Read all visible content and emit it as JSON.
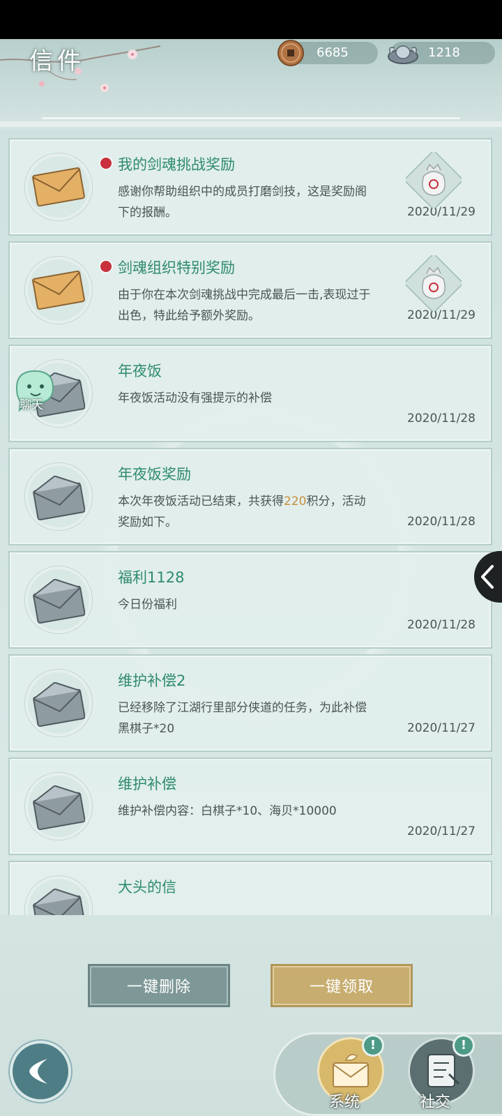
{
  "header": {
    "title": "信件",
    "copper_amount": "6685",
    "silver_amount": "1218"
  },
  "mails": [
    {
      "title": "我的剑魂挑战奖励",
      "body": "感谢你帮助组织中的成员打磨剑技，这是奖励阁下的报酬。",
      "date": "2020/11/29",
      "unread": true,
      "opened": false,
      "has_attachment": true
    },
    {
      "title": "剑魂组织特别奖励",
      "body": "由于你在本次剑魂挑战中完成最后一击,表现过于出色，特此给予额外奖励。",
      "date": "2020/11/29",
      "unread": true,
      "opened": false,
      "has_attachment": true
    },
    {
      "title": "年夜饭",
      "body": "年夜饭活动没有强提示的补偿",
      "date": "2020/11/28",
      "unread": false,
      "opened": true,
      "has_attachment": false
    },
    {
      "title": "年夜饭奖励",
      "body_before": "本次年夜饭活动已结束，共获得",
      "body_highlight": "220",
      "body_after": "积分，活动奖励如下。",
      "date": "2020/11/28",
      "unread": false,
      "opened": true,
      "has_attachment": false
    },
    {
      "title": "福利1128",
      "body": "今日份福利",
      "date": "2020/11/28",
      "unread": false,
      "opened": true,
      "has_attachment": false
    },
    {
      "title": "维护补偿2",
      "body": "已经移除了江湖行里部分侠道的任务，为此补偿黑棋子*20",
      "date": "2020/11/27",
      "unread": false,
      "opened": true,
      "has_attachment": false
    },
    {
      "title": "维护补偿",
      "body": "维护补偿内容：白棋子*10、海贝*10000",
      "date": "2020/11/27",
      "unread": false,
      "opened": true,
      "has_attachment": false
    },
    {
      "title": "大头的信",
      "body": "",
      "date": "",
      "unread": false,
      "opened": true,
      "has_attachment": false
    }
  ],
  "floating": {
    "chat_label": "聊天"
  },
  "actions": {
    "delete_all": "一键删除",
    "claim_all": "一键领取"
  },
  "tabs": {
    "system": "系统",
    "social": "社交",
    "badge": "!"
  },
  "colors": {
    "title_green": "#2e8a6e",
    "unread_red": "#c8313d",
    "highlight_gold": "#c8903a",
    "claim_gold": "#c7ad6f",
    "delete_slate": "#7e9897"
  }
}
